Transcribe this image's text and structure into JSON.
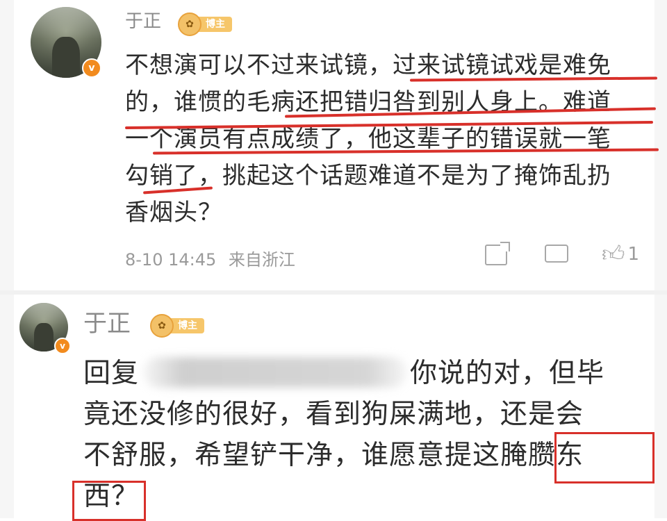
{
  "comments": [
    {
      "username": "于正",
      "badge": "博主",
      "lines": [
        "不想演可以不过来试镜，过来试镜试戏是难免",
        "的，谁惯的毛病还把错归咎到别人身上。难道",
        "一个演员有点成绩了，他这辈子的错误就一笔",
        "勾销了，挑起这个话题难道不是为了掩饰乱扔",
        "香烟头？"
      ],
      "time": "8-10 14:45",
      "location": "来自浙江",
      "like_count": "1"
    },
    {
      "username": "于正",
      "badge": "博主",
      "reply_prefix": "回复",
      "lines": [
        "你说的对，但毕",
        "竟还没修的很好，看到狗屎满地，还是会",
        "不舒服，希望铲干净，谁愿意提这腌臜东",
        "西？"
      ]
    }
  ],
  "colors": {
    "annotation_red": "#d8302a",
    "verified_orange": "#f28b1e",
    "badge_gold": "#f6c66a"
  },
  "icons": {
    "share": "share-icon",
    "comment": "comment-icon",
    "like": "thumbs-up-icon"
  }
}
